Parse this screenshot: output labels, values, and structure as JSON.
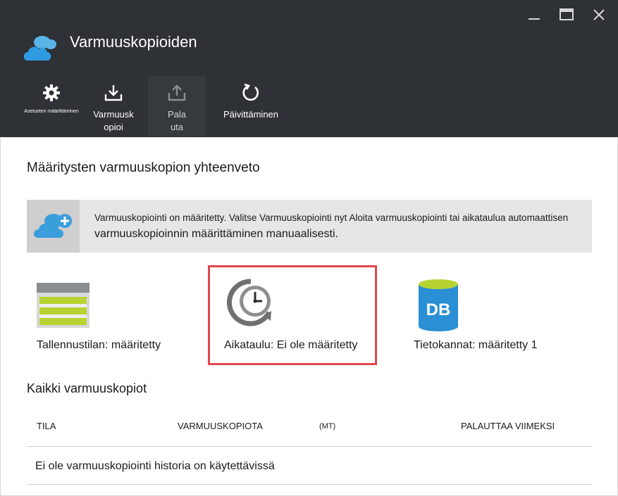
{
  "window": {
    "title": "Varmuuskopioiden",
    "controls": [
      "minimize",
      "maximize",
      "close"
    ]
  },
  "toolbar": {
    "items": [
      {
        "id": "settings",
        "label": "Asetusten määrittäminen",
        "icon": "gear-icon",
        "enabled": true
      },
      {
        "id": "backup",
        "label": "Varmuusk opioi",
        "icon": "download-icon",
        "enabled": true
      },
      {
        "id": "restore",
        "label": "Pala uta",
        "icon": "upload-icon",
        "enabled": false
      },
      {
        "id": "refresh",
        "label": "Päivittäminen",
        "icon": "refresh-icon",
        "enabled": true
      }
    ]
  },
  "summary": {
    "title": "Määritysten varmuuskopion yhteenveto",
    "banner": {
      "icon": "cloud-add-icon",
      "line1": "Varmuuskopiointi on määritetty. Valitse Varmuuskopiointi nyt Aloita varmuuskopiointi tai aikataulua automaattisen",
      "line2": "varmuuskopioinnin määrittäminen manuaalisesti."
    },
    "tiles": [
      {
        "id": "storage",
        "icon": "storage-icon",
        "label": "Tallennustilan: määritetty"
      },
      {
        "id": "schedule",
        "icon": "clock-icon",
        "label": "Aikataulu: Ei ole määritetty",
        "highlighted": true
      },
      {
        "id": "databases",
        "icon": "database-icon",
        "icon_text": "DB",
        "label": "Tietokannat: määritetty 1"
      }
    ]
  },
  "backups": {
    "title": "Kaikki varmuuskopiot",
    "columns": [
      "TILA",
      "VARMUUSKOPIOTA",
      "(MT)",
      "PALAUTTAA VIIMEKSI"
    ],
    "empty_message": "Ei ole varmuuskopiointi historia on käytettävissä"
  },
  "colors": {
    "header_bg": "#2e3135",
    "highlight_border": "#e0474c",
    "cloud_blue": "#1e8fd6",
    "db_blue": "#2a8fd4"
  }
}
